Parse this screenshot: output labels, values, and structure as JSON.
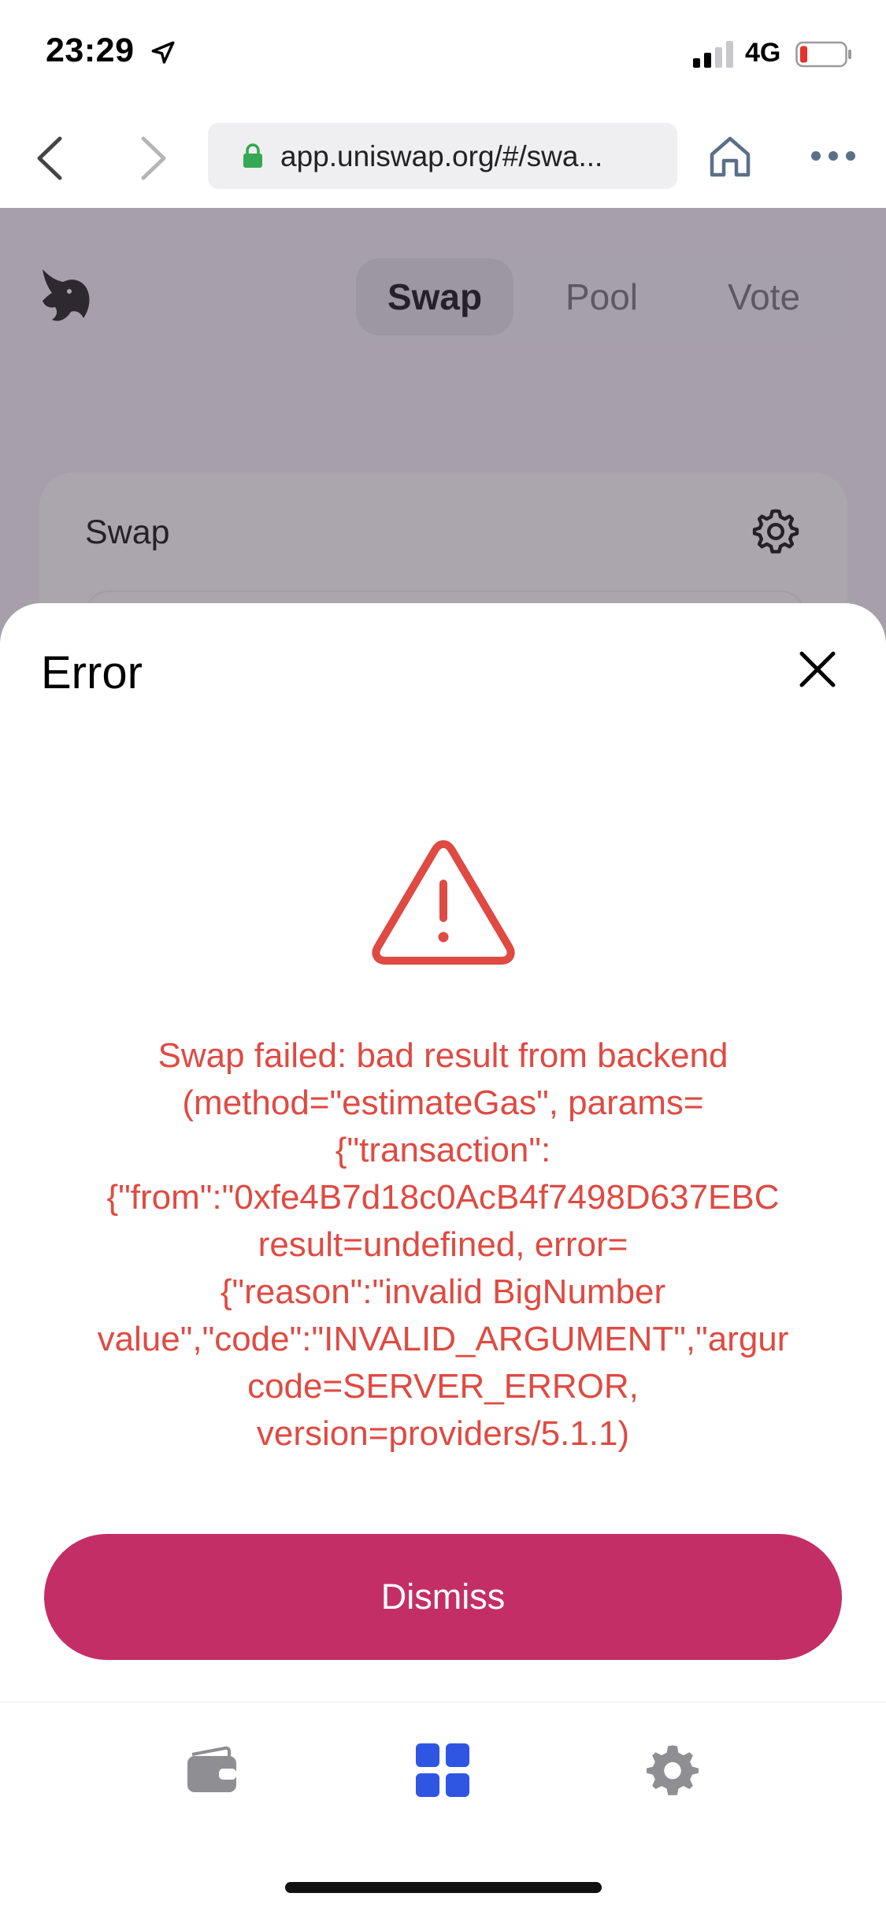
{
  "status_bar": {
    "time": "23:29",
    "network": "4G",
    "icons": [
      "location-arrow-icon",
      "signal-bars-icon",
      "battery-low-icon"
    ]
  },
  "browser": {
    "url": "app.uniswap.org/#/swa...",
    "icons": [
      "back-chevron-icon",
      "forward-chevron-icon",
      "lock-icon",
      "home-icon",
      "more-dots-icon"
    ]
  },
  "page": {
    "tabs": [
      {
        "label": "Swap",
        "active": true
      },
      {
        "label": "Pool",
        "active": false
      },
      {
        "label": "Vote",
        "active": false
      }
    ],
    "card_title": "Swap"
  },
  "modal": {
    "title": "Error",
    "error_lines": [
      "Swap failed: bad result from backend",
      "(method=\"estimateGas\", params=",
      "{\"transaction\":",
      "{\"from\":\"0xfe4B7d18c0AcB4f7498D637EBC",
      "result=undefined, error=",
      "{\"reason\":\"invalid BigNumber",
      "value\",\"code\":\"INVALID_ARGUMENT\",\"argur",
      "code=SERVER_ERROR,",
      "version=providers/5.1.1)"
    ],
    "dismiss_label": "Dismiss"
  },
  "toolbar": {
    "items": [
      "wallet-icon",
      "apps-grid-icon",
      "settings-gear-icon"
    ]
  },
  "colors": {
    "error_red": "#df4a42",
    "dismiss_pink": "#c42e66",
    "apps_blue": "#2f55e3",
    "toolbar_gray": "#8e8e93"
  }
}
